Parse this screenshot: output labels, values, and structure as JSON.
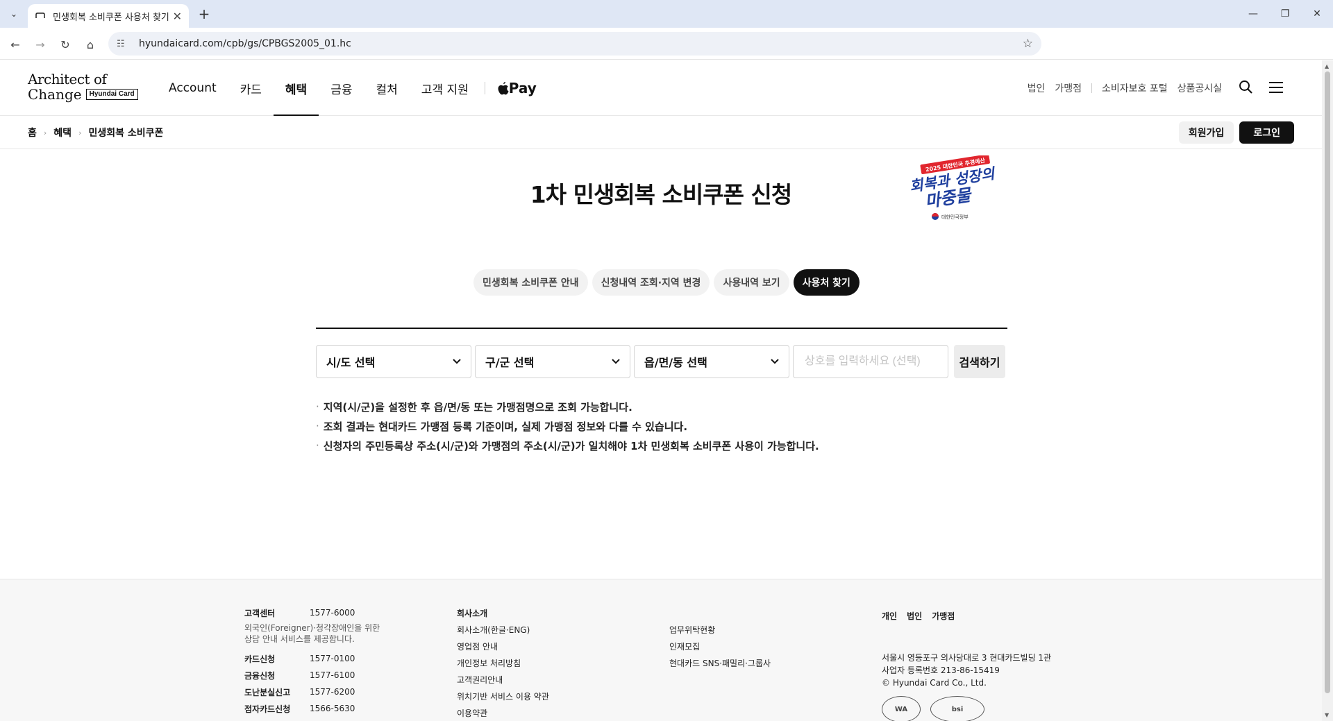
{
  "browser": {
    "tab_title": "민생회복 소비쿠폰 사용처 찾기",
    "url": "hyundaicard.com/cpb/gs/CPBGS2005_01.hc",
    "icons": {
      "tab_menu": "chevron-down-icon",
      "favicon": "card-icon",
      "close": "close-icon",
      "new_tab": "plus-icon",
      "back": "arrow-left-icon",
      "forward": "arrow-right-icon",
      "reload": "reload-icon",
      "home": "home-icon",
      "site_info": "tune-icon",
      "bookmark": "star-icon",
      "minimize": "minimize-icon",
      "restore": "restore-icon",
      "close_window": "close-icon"
    }
  },
  "header": {
    "logo_line1": "Architect of",
    "logo_line2": "Change",
    "logo_badge": "Hyundai Card",
    "nav": [
      {
        "label": "Account"
      },
      {
        "label": "카드"
      },
      {
        "label": "혜택",
        "active": true
      },
      {
        "label": "금융"
      },
      {
        "label": "컬처"
      },
      {
        "label": "고객 지원"
      }
    ],
    "applepay_label": "Pay",
    "util": [
      "법인",
      "가맹점",
      "소비자보호 포털",
      "상품공시실"
    ],
    "icons": {
      "search": "search-icon",
      "menu": "hamburger-menu-icon",
      "apple": "apple-icon"
    }
  },
  "breadcrumb": [
    "홈",
    "혜택",
    "민생회복 소비쿠폰"
  ],
  "auth": {
    "signup": "회원가입",
    "login": "로그인"
  },
  "main": {
    "title": "1차 민생회복 소비쿠폰 신청",
    "campaign": {
      "top": "2025 대한민국 추경예산",
      "line1": "회복과 성장의",
      "line2": "마중물",
      "gov": "대한민국정부"
    },
    "tabs": [
      {
        "label": "민생회복 소비쿠폰 안내"
      },
      {
        "label": "신청내역 조회·지역 변경"
      },
      {
        "label": "사용내역 보기"
      },
      {
        "label": "사용처 찾기",
        "active": true
      }
    ],
    "selects": {
      "sido": "시/도 선택",
      "gugun": "구/군 선택",
      "dong": "읍/면/동 선택"
    },
    "shop_placeholder": "상호를 입력하세요 (선택)",
    "search_button": "검색하기",
    "notes": [
      "지역(시/군)을 설정한 후 읍/면/동 또는 가맹점명으로 조회 가능합니다.",
      "조회 결과는 현대카드 가맹점 등록 기준이며, 실제 가맹점 정보와 다를 수 있습니다.",
      "신청자의 주민등록상 주소(시/군)와 가맹점의 주소(시/군)가 일치해야 1차 민생회복 소비쿠폰 사용이 가능합니다."
    ]
  },
  "footer": {
    "contacts": [
      {
        "label": "고객센터",
        "value": "1577-6000"
      },
      {
        "label": "카드신청",
        "value": "1577-0100"
      },
      {
        "label": "금융신청",
        "value": "1577-6100"
      },
      {
        "label": "도난분실신고",
        "value": "1577-6200"
      },
      {
        "label": "점자카드신청",
        "value": "1566-5630"
      }
    ],
    "foreigner_note_1": "외국인(Foreigner)·청각장애인을 위한",
    "foreigner_note_2": "상담 안내 서비스를 제공합니다.",
    "company_head": "회사소개",
    "company_links": [
      "회사소개(한글·ENG)",
      "영업점 안내",
      "개인정보 처리방침",
      "고객권리안내",
      "위치기반 서비스 이용 약관",
      "이용약관"
    ],
    "other_links": [
      "업무위탁현황",
      "인재모집",
      "현대카드 SNS·패밀리·그룹사"
    ],
    "segments": [
      "개인",
      "법인",
      "가맹점"
    ],
    "address": "서울시 영등포구 의사당대로 3 현대카드빌딩 1관",
    "biz_no": "사업자 등록번호 213-86-15419",
    "copyright": "© Hyundai Card Co., Ltd.",
    "cert1": "WA",
    "cert2": "bsi"
  },
  "colors": {
    "accent": "#111111",
    "campaign_blue": "#1f3f9e",
    "campaign_red": "#e1262e"
  }
}
